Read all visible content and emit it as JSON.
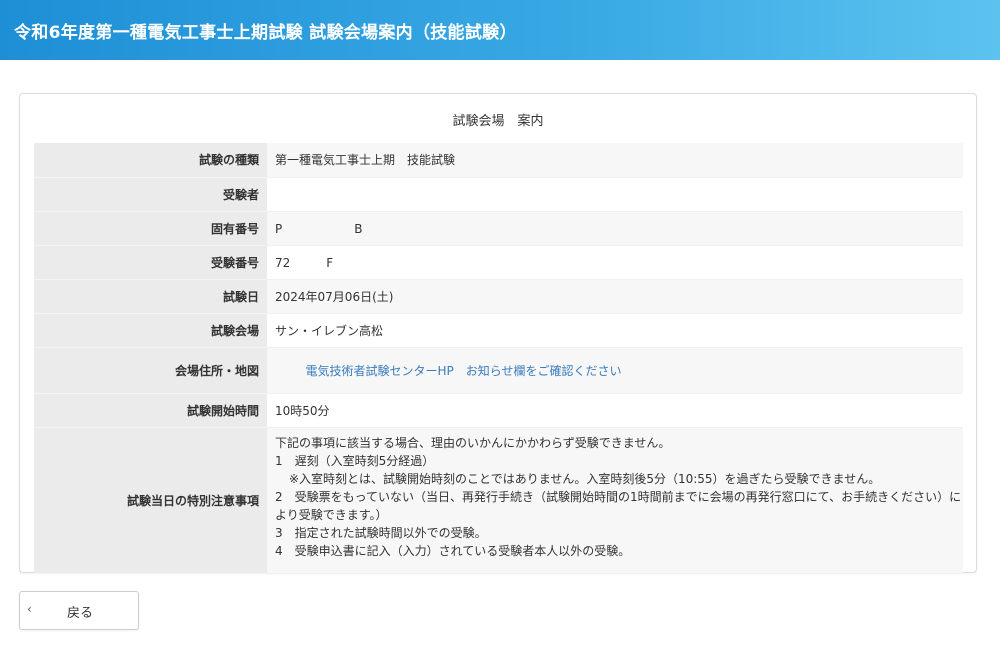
{
  "header": {
    "title": "令和6年度第一種電気工事士上期試験 試験会場案内（技能試験）"
  },
  "card": {
    "title": "試験会場　案内"
  },
  "rows": [
    {
      "label": "試験の種類",
      "value": "第一種電気工事士上期　技能試験"
    },
    {
      "label": "受験者",
      "value": ""
    },
    {
      "label": "固有番号",
      "value": "P　　　　　　B"
    },
    {
      "label": "受験番号",
      "value": "72　　　F"
    },
    {
      "label": "試験日",
      "value": "2024年07月06日(土)"
    },
    {
      "label": "試験会場",
      "value": "サン・イレブン高松"
    },
    {
      "label": "会場住所・地図",
      "value": "電気技術者試験センターHP　お知らせ欄をご確認ください"
    },
    {
      "label": "試験開始時間",
      "value": "10時50分"
    },
    {
      "label": "試験当日の特別注意事項",
      "value": ""
    }
  ],
  "notes": {
    "lines": [
      "下記の事項に該当する場合、理由のいかんにかかわらず受験できません。",
      "1　遅刻（入室時刻5分経過）",
      "※入室時刻とは、試験開始時刻のことではありません。入室時刻後5分（10:55）を過ぎたら受験できません。",
      "2　受験票をもっていない（当日、再発行手続き（試験開始時間の1時間前までに会場の再発行窓口にて、お手続きください）により受験できます。）",
      "3　指定された試験時間以外での受験。",
      "4　受験申込書に記入（入力）されている受験者本人以外の受験。"
    ]
  },
  "back_button": {
    "label": "戻る",
    "icon": "chevron-left-icon"
  },
  "colors": {
    "header_gradient_start": "#1e8fd6",
    "header_gradient_end": "#5cc3ef",
    "label_cell_bg": "#ebebeb",
    "link": "#3a7bbf"
  }
}
